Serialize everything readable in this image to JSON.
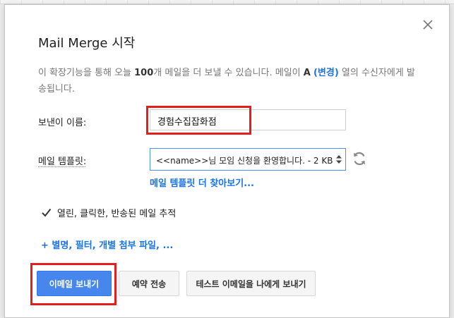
{
  "dialog": {
    "title": "Mail Merge 시작",
    "description": {
      "part1": "이 확장기능을 통해 오늘 ",
      "count": "100",
      "part2": "개 메일을 더 보낼 수 있습니다. 메일이 ",
      "column": "A",
      "change_link": "(변경)",
      "part3": " 열의 수신자에게 발송됩니다."
    },
    "sender": {
      "label": "보낸이 이름:",
      "value": "경험수집잡화점"
    },
    "template": {
      "label": "메일 템플릿:",
      "selected": "<<name>>님 모임 신청을 환영합니다. - 2 KB",
      "more_link": "메일 템플릿 더 찾아보기..."
    },
    "tracking": {
      "checked": true,
      "label": "열린, 클릭한, 반송된 메일 추적"
    },
    "advanced_link": "+ 별명, 필터, 개별 첨부 파일, ...",
    "buttons": {
      "send": "이메일 보내기",
      "schedule": "예약 전송",
      "test": "테스트 이메일을 나에게 보내기"
    }
  },
  "colors": {
    "accent": "#4787ed",
    "link": "#1a73e8",
    "highlight": "#e51d1d"
  },
  "icons": [
    "close-icon",
    "sort-arrows-icon",
    "refresh-icon",
    "checkbox-icon"
  ]
}
